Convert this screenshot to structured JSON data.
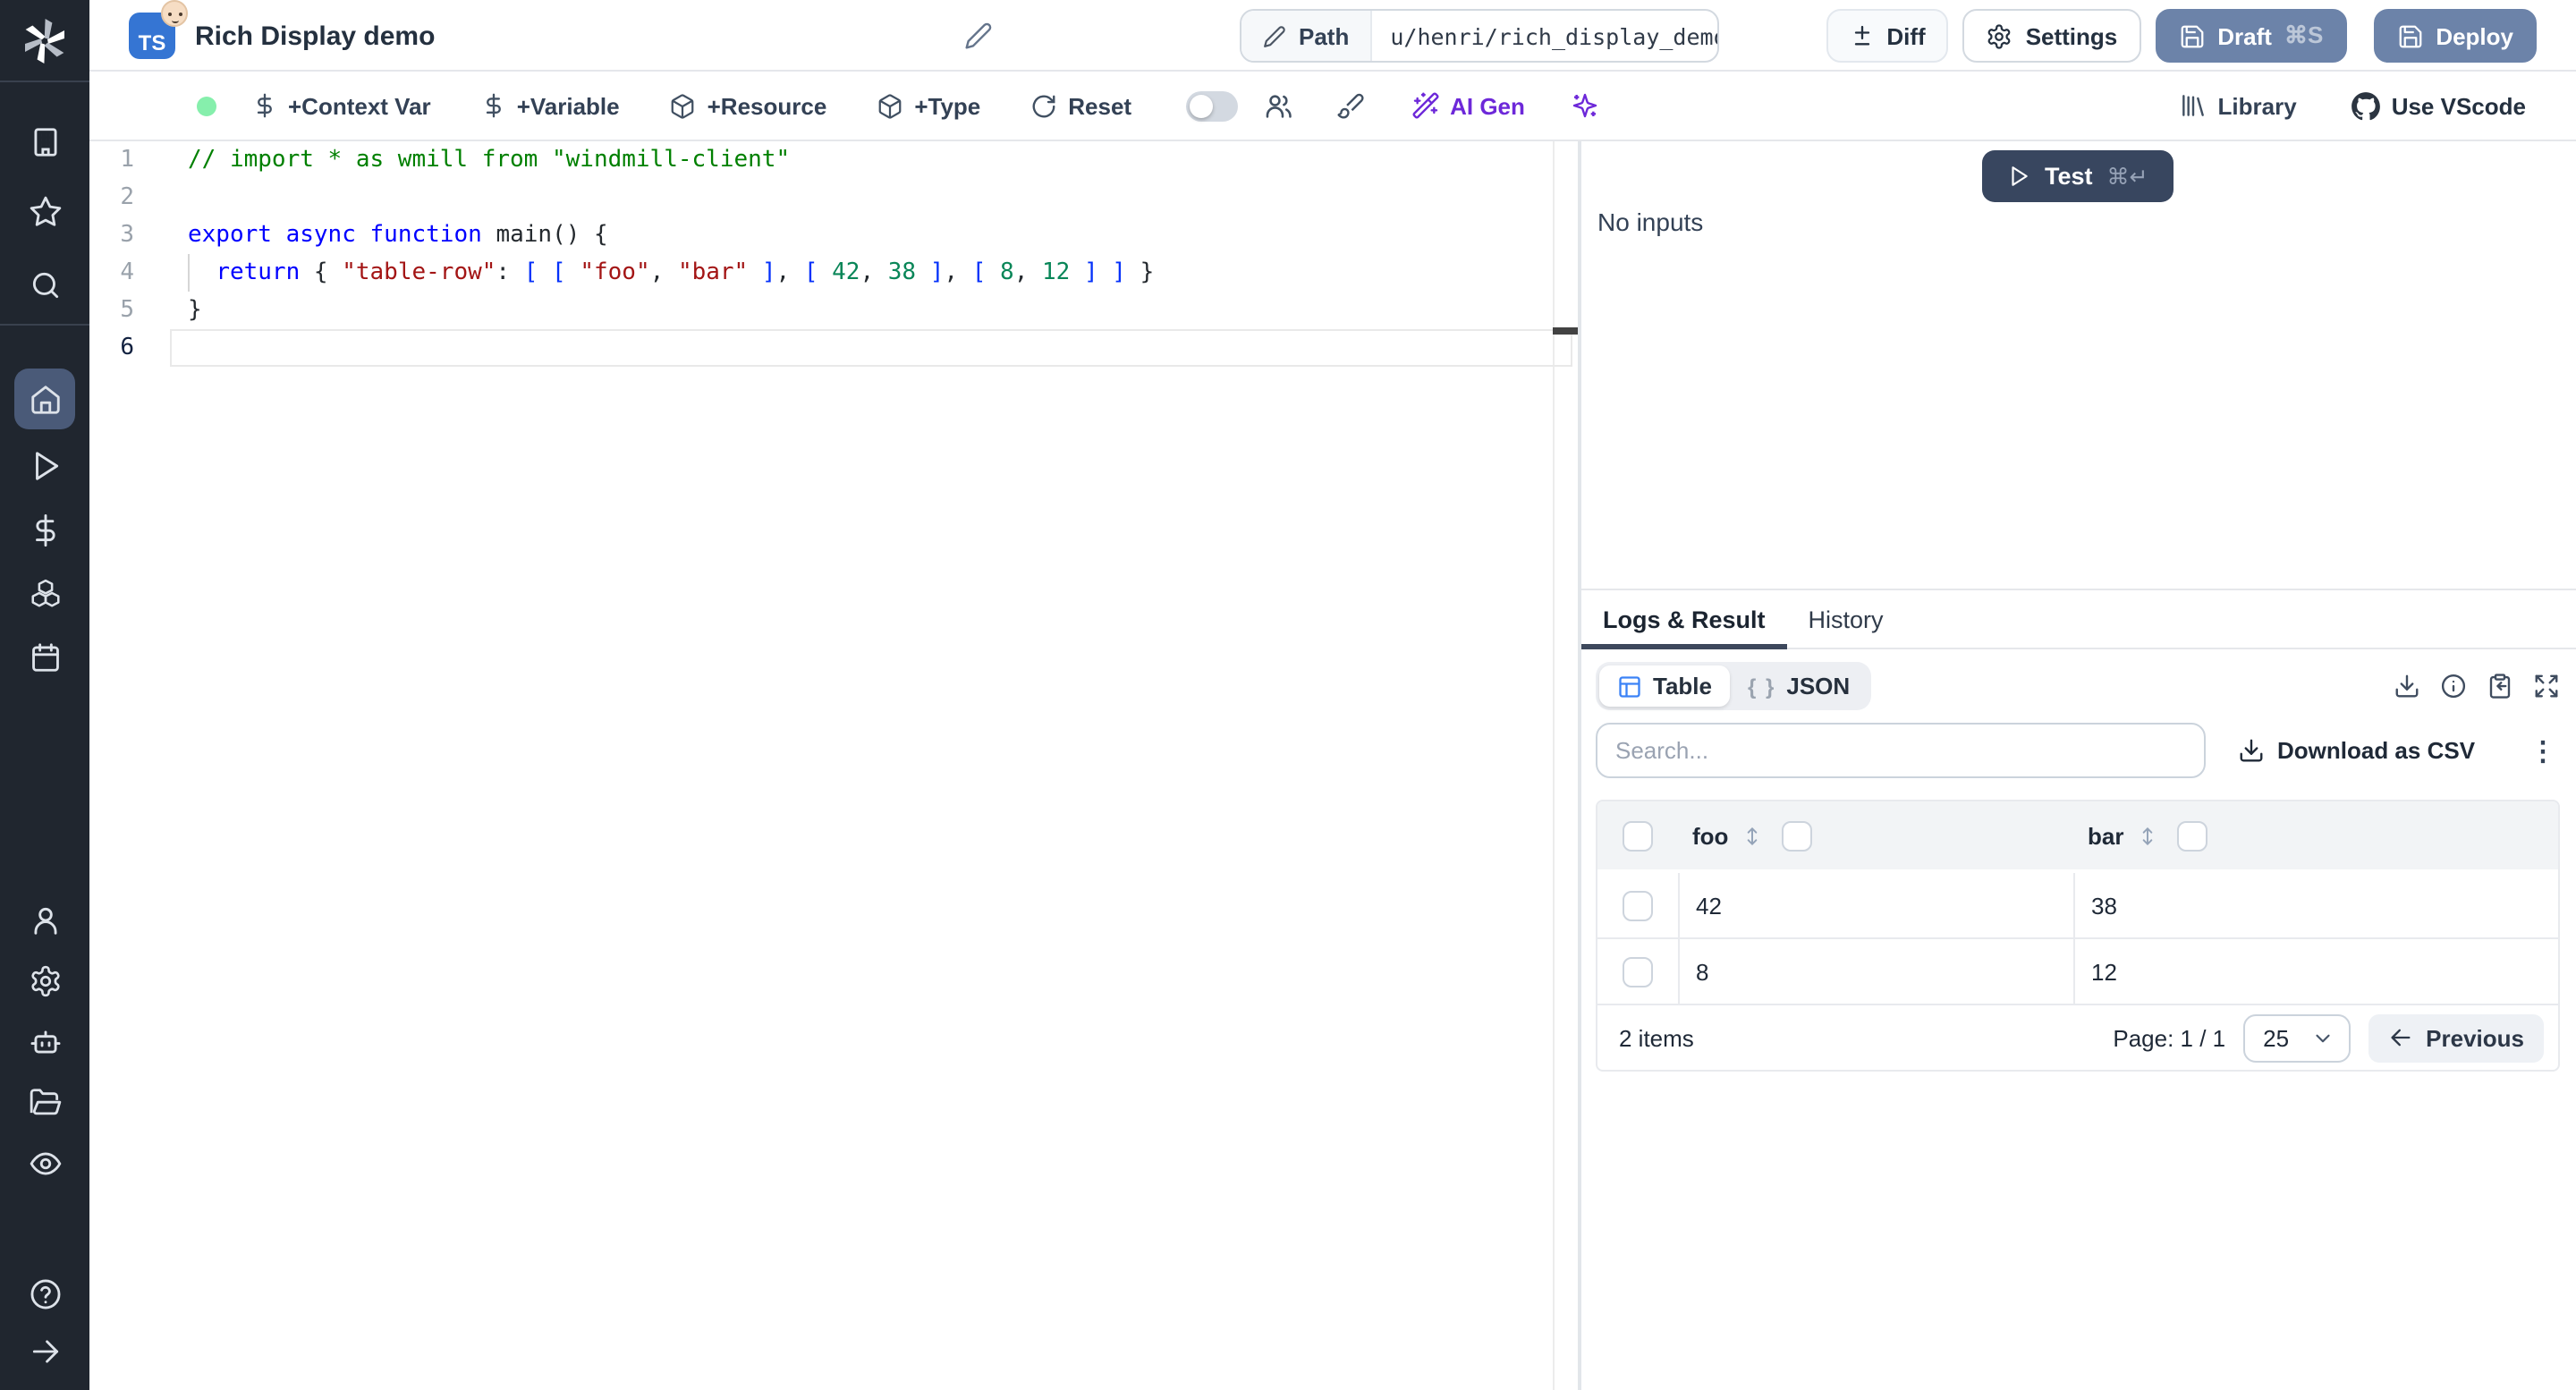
{
  "header": {
    "title": "Rich Display demo",
    "language_badge": "TS",
    "path_label": "Path",
    "path_value": "u/henri/rich_display_demo",
    "diff_label": "Diff",
    "settings_label": "Settings",
    "draft_label": "Draft",
    "draft_shortcut": "⌘S",
    "deploy_label": "Deploy"
  },
  "toolbar": {
    "context_var_label": "+Context Var",
    "variable_label": "+Variable",
    "resource_label": "+Resource",
    "type_label": "+Type",
    "reset_label": "Reset",
    "ai_gen_label": "AI Gen",
    "library_label": "Library",
    "vscode_label": "Use VScode"
  },
  "editor": {
    "syntax_colors": {
      "comment": "#008000",
      "keyword": "#0000ff",
      "string": "#a31515",
      "number": "#098658",
      "bracket": "#0431fa",
      "plain": "#24292e"
    },
    "lines": [
      {
        "num": "1",
        "active": false,
        "tokens": [
          [
            "// import * as wmill from \"windmill-client\"",
            "c"
          ]
        ]
      },
      {
        "num": "2",
        "active": false,
        "tokens": []
      },
      {
        "num": "3",
        "active": false,
        "tokens": [
          [
            "export",
            "k"
          ],
          [
            " ",
            "p"
          ],
          [
            "async",
            "k"
          ],
          [
            " ",
            "p"
          ],
          [
            "function",
            "k"
          ],
          [
            " ",
            "p"
          ],
          [
            "main",
            "p"
          ],
          [
            "() {",
            "p"
          ]
        ]
      },
      {
        "num": "4",
        "active": false,
        "tokens": [
          [
            "  ",
            "p"
          ],
          [
            "return",
            "k"
          ],
          [
            " { ",
            "p"
          ],
          [
            "\"table-row\"",
            "s"
          ],
          [
            ": ",
            "p"
          ],
          [
            "[",
            "b"
          ],
          [
            " ",
            "p"
          ],
          [
            "[",
            "b"
          ],
          [
            " ",
            "p"
          ],
          [
            "\"foo\"",
            "s"
          ],
          [
            ", ",
            "p"
          ],
          [
            "\"bar\"",
            "s"
          ],
          [
            " ",
            "p"
          ],
          [
            "]",
            "b"
          ],
          [
            ", ",
            "p"
          ],
          [
            "[",
            "b"
          ],
          [
            " ",
            "p"
          ],
          [
            "42",
            "n"
          ],
          [
            ", ",
            "p"
          ],
          [
            "38",
            "n"
          ],
          [
            " ",
            "p"
          ],
          [
            "]",
            "b"
          ],
          [
            ", ",
            "p"
          ],
          [
            "[",
            "b"
          ],
          [
            " ",
            "p"
          ],
          [
            "8",
            "n"
          ],
          [
            ", ",
            "p"
          ],
          [
            "12",
            "n"
          ],
          [
            " ",
            "p"
          ],
          [
            "]",
            "b"
          ],
          [
            " ",
            "p"
          ],
          [
            "]",
            "b"
          ],
          [
            " }",
            "p"
          ]
        ]
      },
      {
        "num": "5",
        "active": false,
        "tokens": [
          [
            "}",
            "p"
          ]
        ]
      },
      {
        "num": "6",
        "active": true,
        "tokens": []
      }
    ]
  },
  "run": {
    "test_label": "Test",
    "test_shortcut": "⌘↵",
    "no_inputs": "No inputs"
  },
  "tabs": {
    "logs_result": "Logs & Result",
    "history": "History"
  },
  "result": {
    "view_table_label": "Table",
    "view_json_label": "JSON",
    "json_braces": "{ }",
    "search_placeholder": "Search...",
    "download_csv_label": "Download as CSV",
    "kebab_glyph": "⋮",
    "table": {
      "columns": [
        "foo",
        "bar"
      ],
      "rows": [
        [
          "42",
          "38"
        ],
        [
          "8",
          "12"
        ]
      ],
      "items_label": "2 items",
      "page_label": "Page: 1 / 1",
      "page_size": "25",
      "previous_label": "Previous"
    }
  },
  "colors": {
    "sidebar_bg": "#20262f",
    "sidebar_active": "#4a5a78",
    "slate_button": "#6c83a9",
    "test_button": "#38465f",
    "ai_purple": "#6d28d9",
    "status_green": "#86efac",
    "ts_badge_blue": "#3575d3",
    "table_icon_blue": "#3b82f6"
  }
}
